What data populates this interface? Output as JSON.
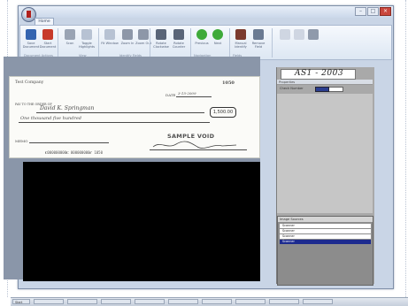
{
  "window": {
    "title": "",
    "tab_home": "Home"
  },
  "ribbon": {
    "buttons": [
      {
        "label": "Save Document",
        "icon": "save-icon",
        "color": "#3565b0"
      },
      {
        "label": "Start Document",
        "icon": "start-icon",
        "color": "#c73a2a"
      },
      {
        "label": "Scan",
        "icon": "scan-icon",
        "color": "#9aa4b4"
      },
      {
        "label": "Toggle Highlights",
        "icon": "highlight-icon",
        "color": "#b7c2d3"
      },
      {
        "label": "Fit Window",
        "icon": "fit-icon",
        "color": "#b7c2d3"
      },
      {
        "label": "Zoom In",
        "icon": "zoom-in-icon",
        "color": "#8d97a8"
      },
      {
        "label": "Zoom Out",
        "icon": "zoom-out-icon",
        "color": "#8d97a8"
      },
      {
        "label": "Rotate Clockwise",
        "icon": "rotate-cw-icon",
        "color": "#5a6578"
      },
      {
        "label": "Rotate Counter",
        "icon": "rotate-ccw-icon",
        "color": "#5a6578"
      },
      {
        "label": "Previous",
        "icon": "previous-icon",
        "color": "#3faa3a"
      },
      {
        "label": "Next",
        "icon": "next-icon",
        "color": "#3faa3a"
      },
      {
        "label": "Manual Identify",
        "icon": "identify-icon",
        "color": "#7b3a2e"
      },
      {
        "label": "Remove Field",
        "icon": "remove-field-icon",
        "color": "#6a7a92"
      },
      {
        "label": "",
        "icon": "disabled-a-icon",
        "color": "#cfd6e2"
      },
      {
        "label": "",
        "icon": "disabled-b-icon",
        "color": "#cfd6e2"
      },
      {
        "label": "",
        "icon": "settings-icon",
        "color": "#8f9aab"
      }
    ],
    "groups": [
      "Document Actions",
      "View",
      "Identify Fields",
      "Navigation",
      "Fields"
    ]
  },
  "cheque": {
    "payee_label": "PAY TO THE ORDER OF",
    "payee_value": "David K. Springman",
    "amount_box": "1,500.00",
    "date_label": "DATE",
    "date_value": "3-15-2009",
    "check_number": "1050",
    "written_amount": "One thousand five hundred",
    "memo_label": "MEMO",
    "bank_name": "Test Company",
    "void_text": "SAMPLE VOID",
    "micr_line": "⑆000000000⑆ 000000000⑈ 1050"
  },
  "right_panel": {
    "micr_preview": "AS1 - 2003",
    "header": "Properties",
    "field_label": "Check Number",
    "list_header": "Image Sources",
    "list_items": [
      "Scanner",
      "Scanner",
      "Scanner",
      "Scanner"
    ]
  },
  "taskbar": {
    "items": [
      "Start",
      "",
      "",
      "",
      "",
      "",
      "",
      "",
      "",
      ""
    ]
  }
}
